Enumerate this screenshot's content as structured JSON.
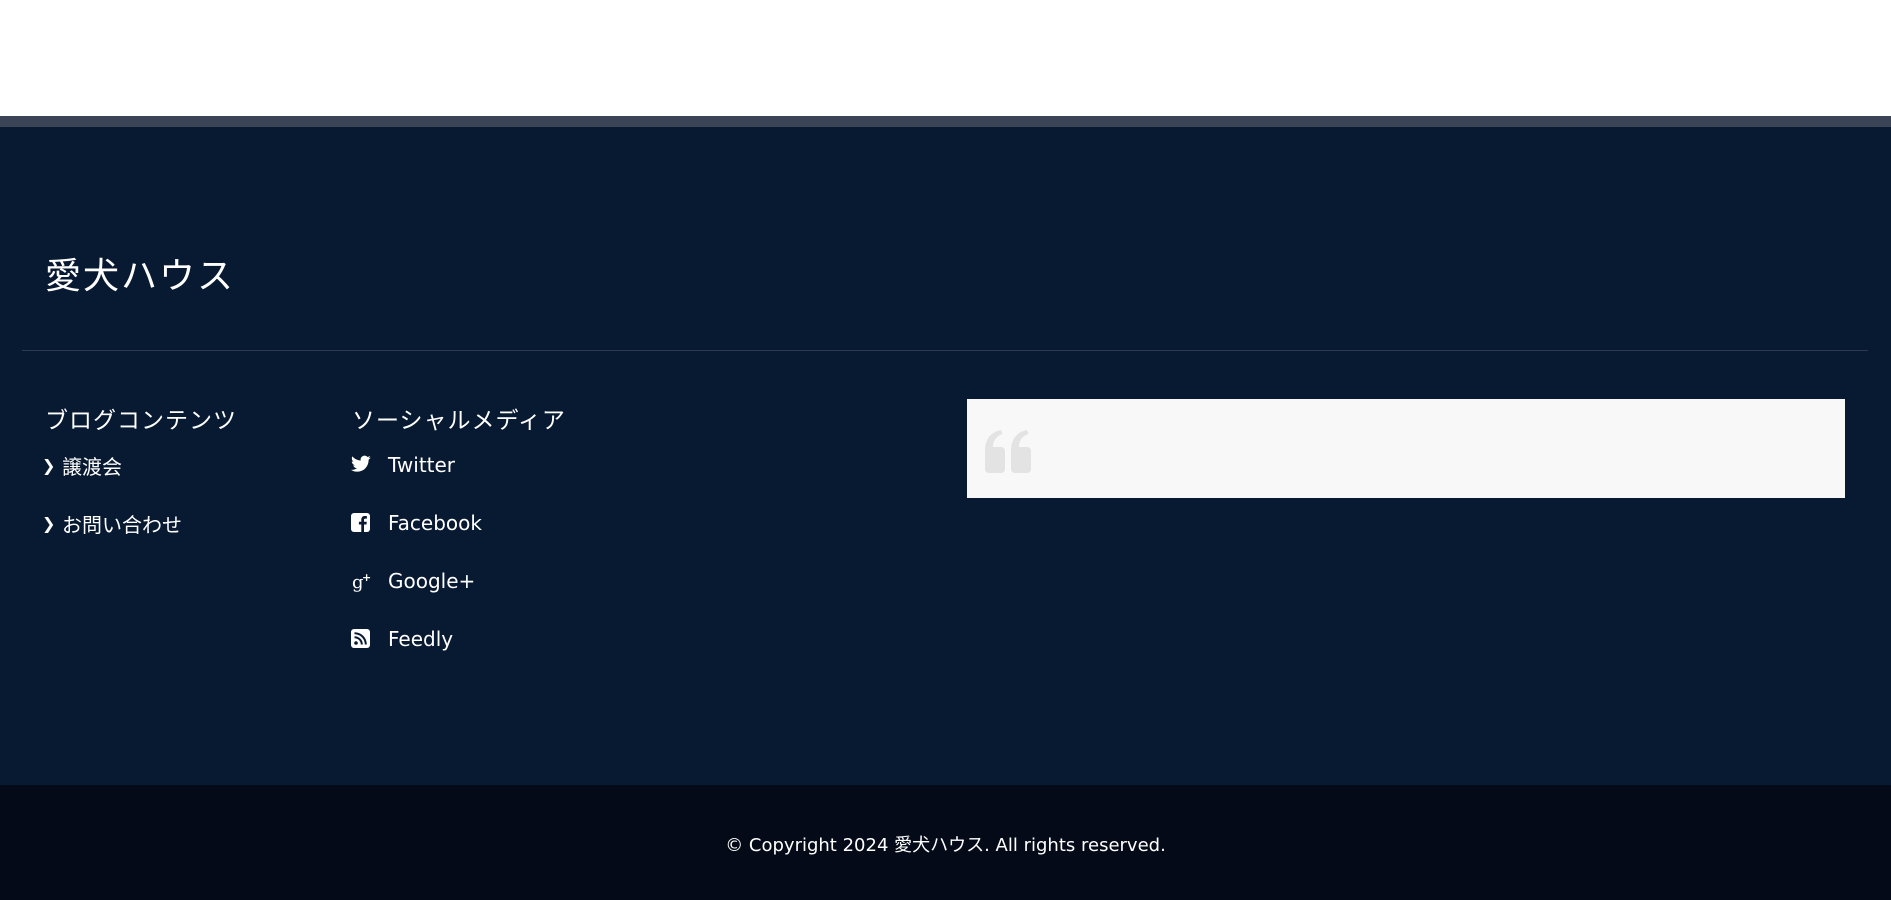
{
  "site": {
    "title": "愛犬ハウス"
  },
  "blog": {
    "heading": "ブログコンテンツ",
    "items": [
      {
        "label": "譲渡会",
        "icon": "chevron-right-icon"
      },
      {
        "label": "お問い合わせ",
        "icon": "chevron-right-icon"
      }
    ]
  },
  "social": {
    "heading": "ソーシャルメディア",
    "items": [
      {
        "label": "Twitter",
        "icon": "twitter-icon"
      },
      {
        "label": "Facebook",
        "icon": "facebook-icon"
      },
      {
        "label": "Google+",
        "icon": "google-plus-icon"
      },
      {
        "label": "Feedly",
        "icon": "feedly-rss-icon"
      }
    ]
  },
  "quote": {
    "icon": "quote-icon"
  },
  "footer": {
    "copyright": "© Copyright 2024 愛犬ハウス. All rights reserved."
  },
  "colors": {
    "footer_bg": "#081932",
    "bottom_bar_bg": "#040a18",
    "top_band": "#3b4457",
    "quote_bg": "#f8f8f8"
  }
}
